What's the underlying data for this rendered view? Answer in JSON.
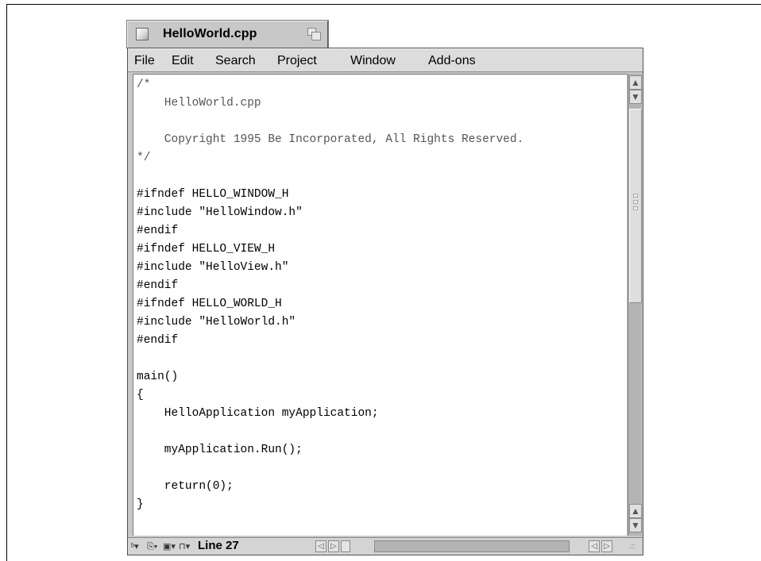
{
  "window": {
    "title": "HelloWorld.cpp"
  },
  "menu": [
    "File",
    "Edit",
    "Search",
    "Project",
    "Window",
    "Add-ons"
  ],
  "code": [
    {
      "text": "/*",
      "style": "comment"
    },
    {
      "text": "    HelloWorld.cpp",
      "style": "comment"
    },
    {
      "text": "",
      "style": "plain"
    },
    {
      "text": "    Copyright 1995 Be Incorporated, All Rights Reserved.",
      "style": "comment"
    },
    {
      "text": "*/",
      "style": "comment"
    },
    {
      "text": "",
      "style": "plain"
    },
    {
      "text": "#ifndef HELLO_WINDOW_H",
      "style": "plain"
    },
    {
      "text": "#include \"HelloWindow.h\"",
      "style": "plain"
    },
    {
      "text": "#endif",
      "style": "plain"
    },
    {
      "text": "#ifndef HELLO_VIEW_H",
      "style": "plain"
    },
    {
      "text": "#include \"HelloView.h\"",
      "style": "plain"
    },
    {
      "text": "#endif",
      "style": "plain"
    },
    {
      "text": "#ifndef HELLO_WORLD_H",
      "style": "plain"
    },
    {
      "text": "#include \"HelloWorld.h\"",
      "style": "plain"
    },
    {
      "text": "#endif",
      "style": "plain"
    },
    {
      "text": "",
      "style": "plain"
    },
    {
      "text": "main()",
      "style": "plain"
    },
    {
      "text": "{",
      "style": "plain"
    },
    {
      "text": "    HelloApplication myApplication;",
      "style": "plain"
    },
    {
      "text": "",
      "style": "plain"
    },
    {
      "text": "    myApplication.Run();",
      "style": "plain"
    },
    {
      "text": "",
      "style": "plain"
    },
    {
      "text": "    return(0);",
      "style": "plain"
    },
    {
      "text": "}",
      "style": "plain"
    }
  ],
  "status": {
    "line_label": "Line 27"
  },
  "icons": {
    "close": "close-box",
    "zoom": "zoom-box",
    "scroll_up": "arrow-up",
    "scroll_down": "arrow-down",
    "scroll_left": "arrow-left",
    "scroll_right": "arrow-right"
  }
}
